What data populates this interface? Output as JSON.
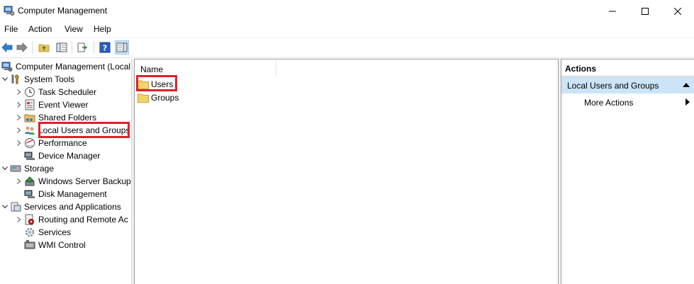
{
  "window": {
    "title": "Computer Management",
    "icon": "computer-management-icon"
  },
  "menu": [
    "File",
    "Action",
    "View",
    "Help"
  ],
  "toolbar": {
    "icons": [
      "back-arrow-icon",
      "forward-arrow-icon",
      "up-folder-icon",
      "show-hide-tree-icon",
      "export-list-icon",
      "help-icon",
      "show-hide-action-pane-icon"
    ]
  },
  "tree": {
    "root": "Computer Management (Local",
    "system_tools": "System Tools",
    "task_scheduler": "Task Scheduler",
    "event_viewer": "Event Viewer",
    "shared_folders": "Shared Folders",
    "local_users_groups": "Local Users and Groups",
    "performance": "Performance",
    "device_manager": "Device Manager",
    "storage": "Storage",
    "windows_server_backup": "Windows Server Backup",
    "disk_management": "Disk Management",
    "services_apps": "Services and Applications",
    "routing": "Routing and Remote Ac",
    "services": "Services",
    "wmi_control": "WMI Control"
  },
  "list": {
    "column_name": "Name",
    "items": [
      "Users",
      "Groups"
    ]
  },
  "actions": {
    "header": "Actions",
    "section": "Local Users and Groups",
    "more_actions": "More Actions"
  },
  "colors": {
    "highlight_red": "#e0202a",
    "selection_blue": "#cce4f7",
    "folder_yellow": "#f5d36b"
  }
}
